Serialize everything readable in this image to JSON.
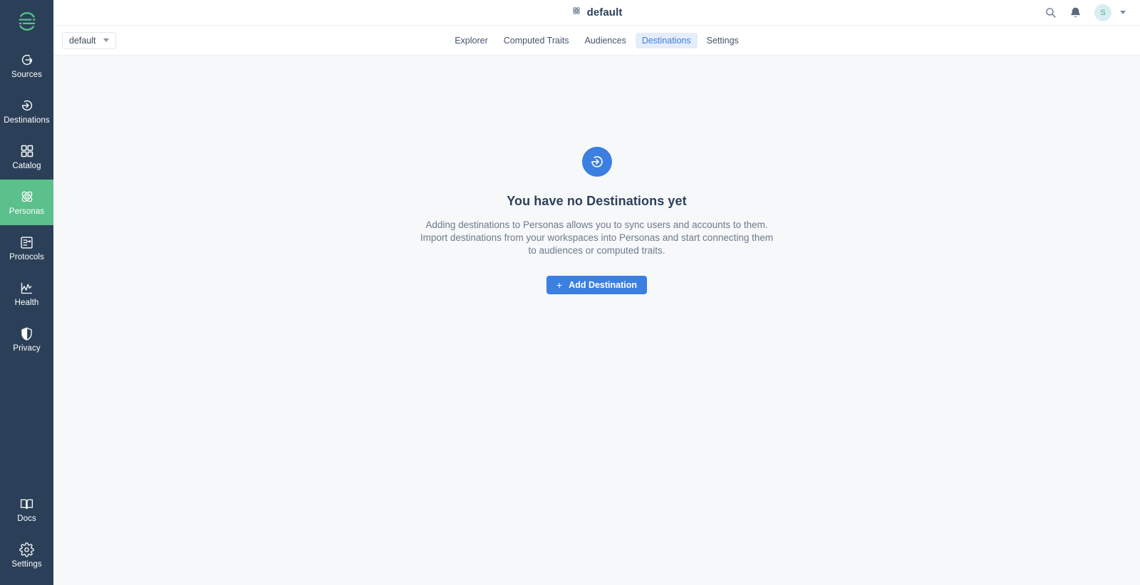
{
  "sidebar": {
    "logo": {
      "name": "segment-logo",
      "alt": "Segment"
    },
    "items": [
      {
        "id": "sources",
        "label": "Sources",
        "icon": "sources-icon",
        "active": false
      },
      {
        "id": "destinations",
        "label": "Destinations",
        "icon": "destinations-icon",
        "active": false
      },
      {
        "id": "catalog",
        "label": "Catalog",
        "icon": "catalog-icon",
        "active": false
      },
      {
        "id": "personas",
        "label": "Personas",
        "icon": "personas-icon",
        "active": true
      },
      {
        "id": "protocols",
        "label": "Protocols",
        "icon": "protocols-icon",
        "active": false
      },
      {
        "id": "health",
        "label": "Health",
        "icon": "health-icon",
        "active": false
      },
      {
        "id": "privacy",
        "label": "Privacy",
        "icon": "privacy-icon",
        "active": false
      }
    ],
    "bottom_items": [
      {
        "id": "docs",
        "label": "Docs",
        "icon": "docs-icon"
      },
      {
        "id": "settings",
        "label": "Settings",
        "icon": "settings-icon"
      }
    ],
    "active_color": "#5bc08c",
    "background_color": "#2b4058"
  },
  "topbar": {
    "title": "default",
    "title_icon": "personas-icon",
    "search_icon": "search-icon",
    "notifications_icon": "bell-icon",
    "avatar_initial": "S",
    "account_caret_icon": "chevron-down-icon"
  },
  "tabbar": {
    "environment_selector": {
      "value": "default",
      "caret_icon": "chevron-down-icon"
    },
    "tabs": [
      {
        "id": "explorer",
        "label": "Explorer",
        "active": false
      },
      {
        "id": "computed-traits",
        "label": "Computed Traits",
        "active": false
      },
      {
        "id": "audiences",
        "label": "Audiences",
        "active": false
      },
      {
        "id": "destinations",
        "label": "Destinations",
        "active": true
      },
      {
        "id": "settings",
        "label": "Settings",
        "active": false
      }
    ],
    "active_tab_bg": "#e5edfb",
    "active_tab_color": "#3b7fe0"
  },
  "empty_state": {
    "icon": "destinations-icon",
    "icon_bg": "#3b7fe0",
    "title": "You have no Destinations yet",
    "description": "Adding destinations to Personas allows you to sync users and accounts to them. Import destinations from your workspaces into Personas and start connecting them to audiences or computed traits.",
    "button": {
      "label": "Add Destination",
      "plus_icon": "plus-icon",
      "color": "#3b7fe0"
    }
  }
}
